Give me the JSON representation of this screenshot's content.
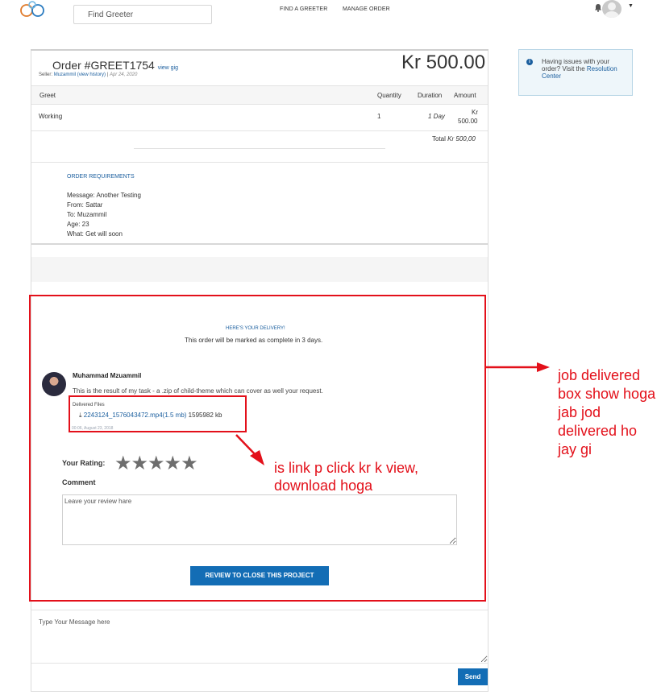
{
  "header": {
    "search_placeholder": "Find Greeter",
    "nav_find": "FIND A GREETER",
    "nav_manage": "MANAGE ORDER"
  },
  "order": {
    "title": "Order #GREET1754",
    "view_gig": "view gig",
    "seller_prefix": "Seller:",
    "seller_name": "Muzammil",
    "view_history": "(view history)",
    "separator": "|",
    "date": "Apr 24, 2020",
    "price": "Kr 500.00",
    "columns": {
      "item": "Greet",
      "quantity": "Quantity",
      "duration": "Duration",
      "amount": "Amount"
    },
    "row": {
      "item": "Working",
      "quantity": "1",
      "duration": "1 Day",
      "amount_currency": "Kr",
      "amount_value": "500.00"
    },
    "total_label": "Total",
    "total_value": "Kr 500,00"
  },
  "requirements": {
    "title": "ORDER REQUIREMENTS",
    "lines": [
      "Message: Another Testing",
      "From: Sattar",
      "To: Muzammil",
      "Age: 23",
      "What: Get will soon"
    ]
  },
  "delivery": {
    "title": "HERE'S YOUR DELIVERY!",
    "subtitle": "This order will be marked as complete in 3 days.",
    "user_name": "Muhammad Mzuammil",
    "message": "This is the result of my task - a .zip of child-theme which can cover as well your request.",
    "files_label": "Delivered Files",
    "file_name": "2243124_1576043472.mp4(1.5 mb)",
    "file_size": "1595982 kb",
    "file_time": "00:06, August 23, 2018",
    "rating_label": "Your Rating:",
    "rating": 5,
    "rating_max": 5,
    "comment_label": "Comment",
    "comment_placeholder": "Leave your review hare",
    "review_button": "REVIEW TO CLOSE THIS PROJECT"
  },
  "message_box": {
    "placeholder": "Type Your Message here",
    "send_label": "Send"
  },
  "help": {
    "text": "Having issues with your order? Visit the",
    "link": "Resolution Center"
  },
  "annotations": {
    "right_note": "job delivered box show hoga jab jod delivered ho jay gi",
    "middle_note": "is link p click kr k view, download hoga",
    "color": "#e3101a"
  },
  "colors": {
    "accent": "#136db5",
    "link": "#1a5e9e",
    "annotation": "#e3101a"
  }
}
